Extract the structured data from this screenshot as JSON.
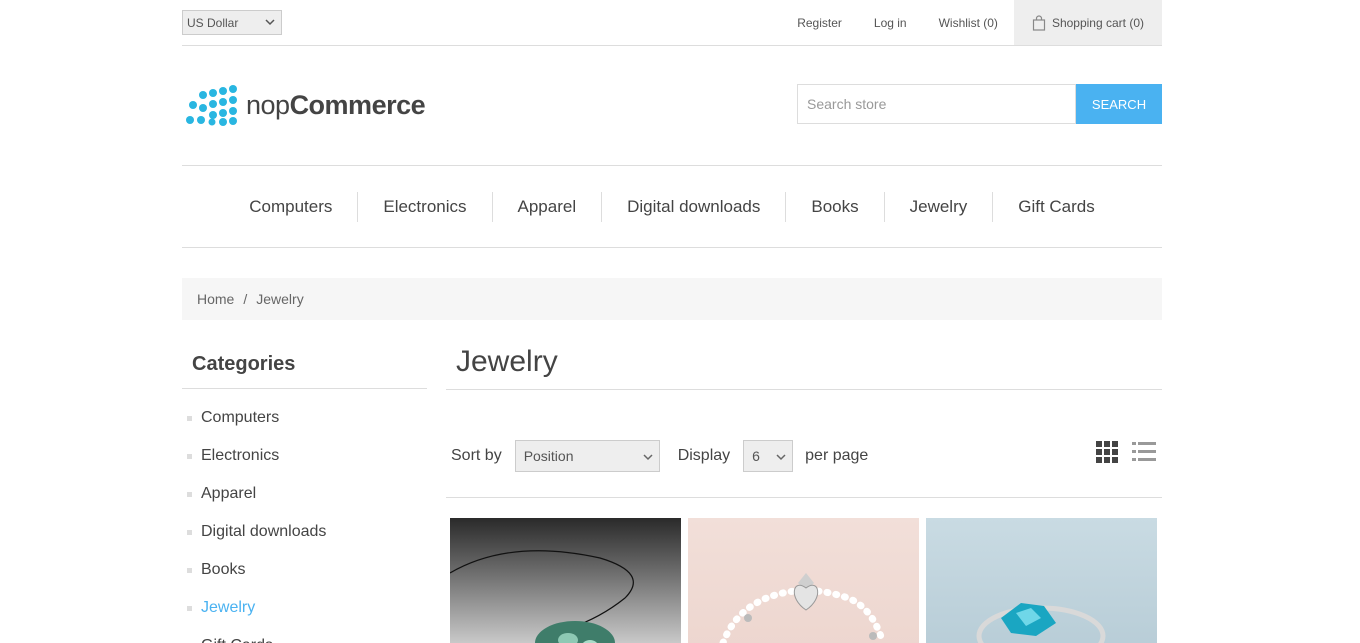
{
  "header": {
    "currency": "US Dollar",
    "links": {
      "register": "Register",
      "login": "Log in",
      "wishlist": "Wishlist (0)",
      "cart": "Shopping cart (0)"
    },
    "logo": {
      "prefix": "nop",
      "suffix": "Commerce"
    },
    "search": {
      "placeholder": "Search store",
      "button": "SEARCH"
    }
  },
  "menu": [
    "Computers",
    "Electronics",
    "Apparel",
    "Digital downloads",
    "Books",
    "Jewelry",
    "Gift Cards"
  ],
  "breadcrumb": {
    "home": "Home",
    "separator": "/",
    "current": "Jewelry"
  },
  "sidebar": {
    "title": "Categories",
    "items": [
      "Computers",
      "Electronics",
      "Apparel",
      "Digital downloads",
      "Books",
      "Jewelry",
      "Gift Cards"
    ],
    "active_index": 5
  },
  "main": {
    "title": "Jewelry",
    "sort_label": "Sort by",
    "sort_value": "Position",
    "display_label": "Display",
    "display_value": "6",
    "per_page_label": "per page"
  },
  "colors": {
    "accent": "#4ab2f1"
  }
}
